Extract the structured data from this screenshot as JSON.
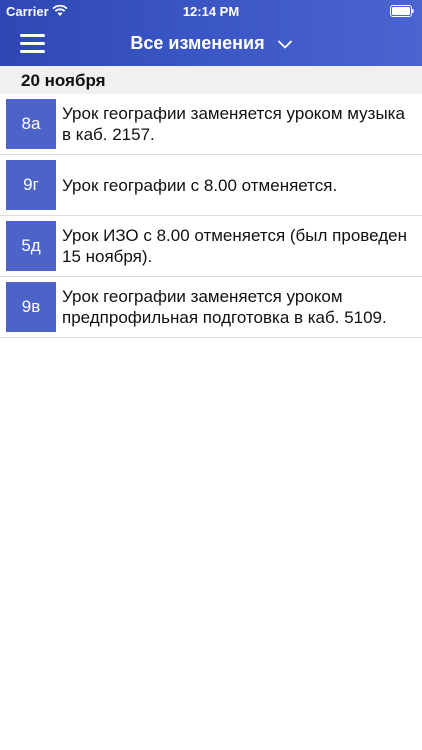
{
  "status_bar": {
    "carrier": "Carrier",
    "time": "12:14 PM"
  },
  "nav": {
    "title": "Все изменения",
    "menu_icon": "hamburger-icon",
    "dropdown_icon": "chevron-down-icon"
  },
  "colors": {
    "nav_bar": "#3a56c4",
    "badge": "#4c64c9",
    "section_bg": "#f0f0f0"
  },
  "section": {
    "date": "20 ноября"
  },
  "items": [
    {
      "class": "8а",
      "text": "Урок географии заменяется уроком музыка в каб. 2157."
    },
    {
      "class": "9г",
      "text": "Урок географии с 8.00 отменяется."
    },
    {
      "class": "5д",
      "text": "Урок ИЗО с 8.00 отменяется (был проведен 15 ноября)."
    },
    {
      "class": "9в",
      "text": "Урок географии заменяется уроком предпрофильная подготовка в каб. 5109."
    }
  ]
}
